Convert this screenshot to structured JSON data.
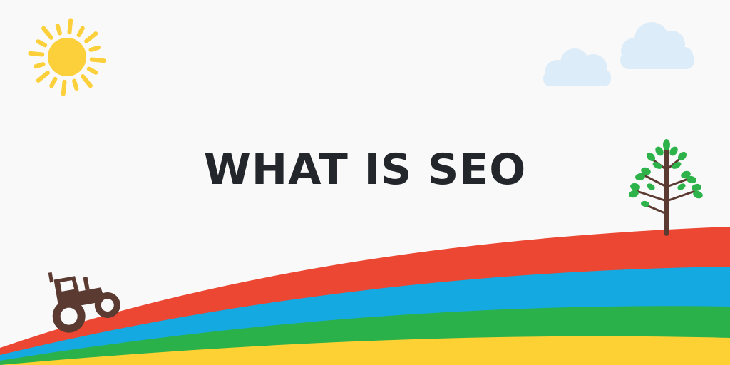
{
  "headline": {
    "text": "WHAT IS SEO"
  },
  "colors": {
    "background": "#f9f9f9",
    "headline": "#23272b",
    "sun": "#fcd03a",
    "cloud": "#dcecf8",
    "band_red": "#ec4732",
    "band_blue": "#14a9e0",
    "band_green": "#2bb14a",
    "band_yellow": "#fdd134",
    "tree_trunk": "#5a3a31",
    "tree_leaves": "#2db34a",
    "tractor": "#5a3a31"
  },
  "icons": [
    "sun-icon",
    "cloud-icon",
    "tree-icon",
    "tractor-icon"
  ]
}
